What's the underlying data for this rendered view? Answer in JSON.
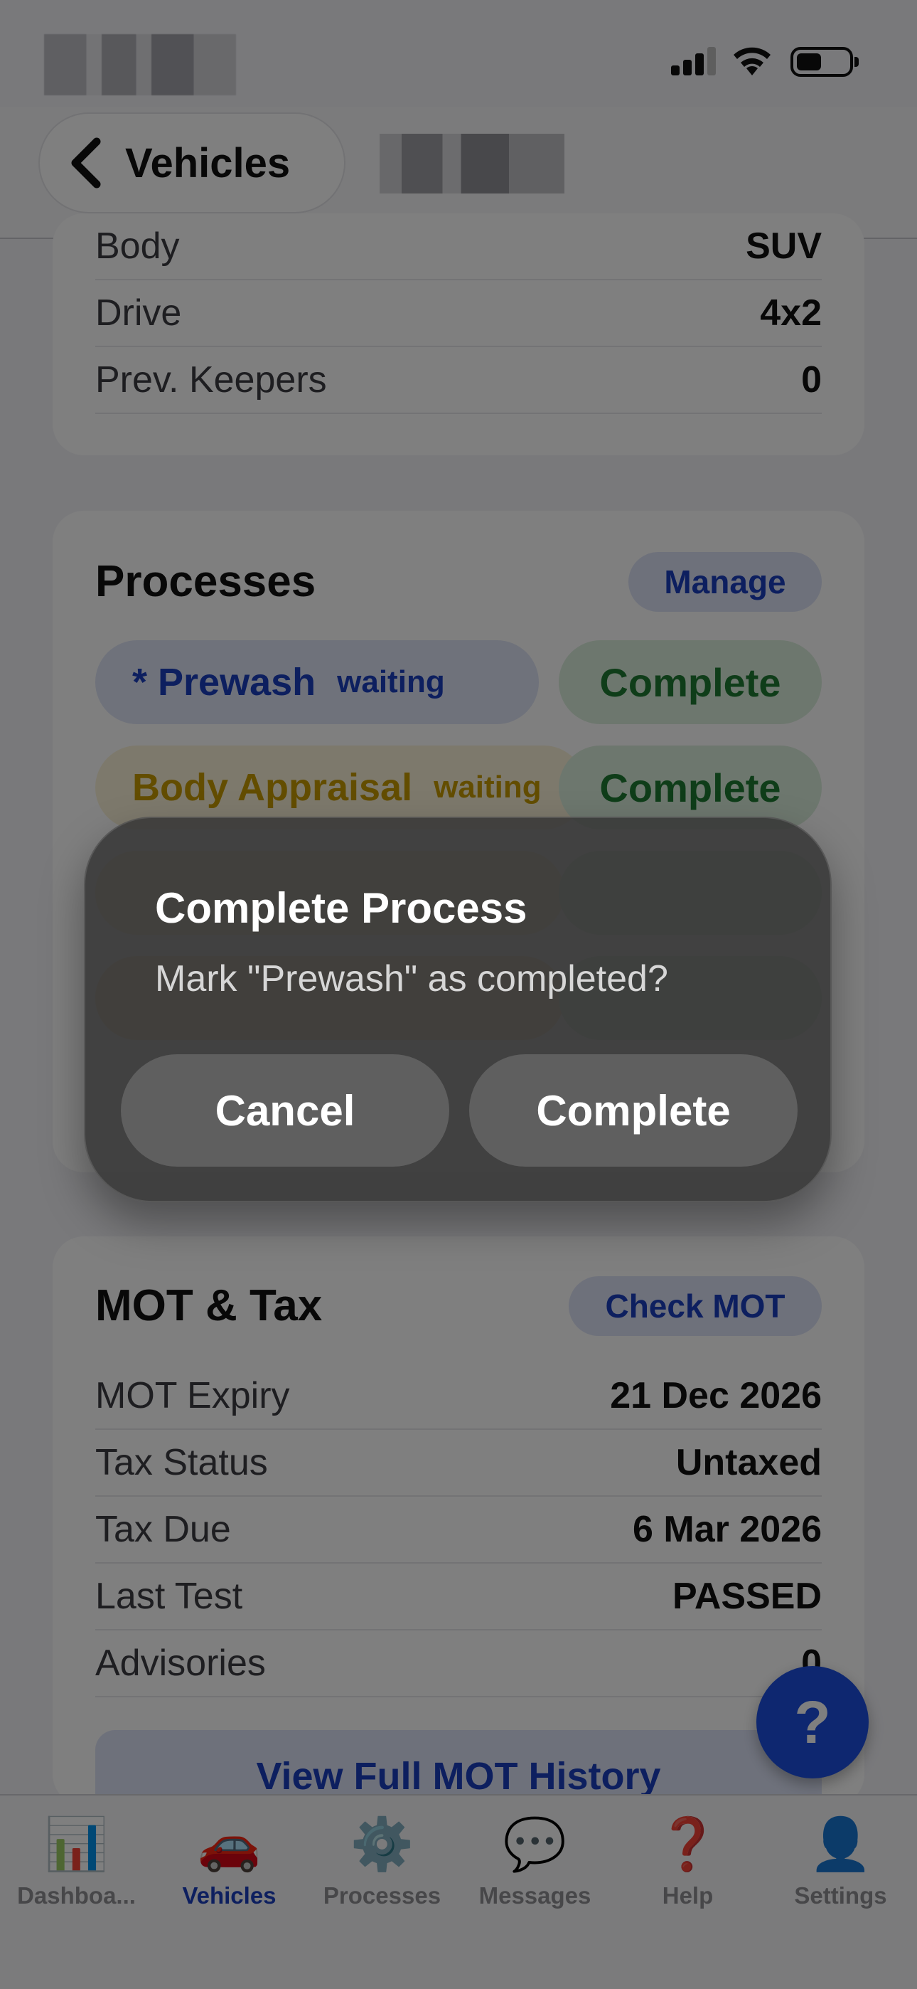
{
  "nav": {
    "back_label": "Vehicles"
  },
  "details": {
    "rows": [
      {
        "label": "Body",
        "value": "SUV"
      },
      {
        "label": "Drive",
        "value": "4x2"
      },
      {
        "label": "Prev. Keepers",
        "value": "0"
      }
    ]
  },
  "processes": {
    "title": "Processes",
    "manage_label": "Manage",
    "items": [
      {
        "name": "* Prewash",
        "state": "waiting",
        "action": "Complete",
        "chip_bg": "#dfe5f7",
        "color": "#1a3fbf"
      },
      {
        "name": "Body Appraisal",
        "state": "waiting",
        "action": "Complete",
        "chip_bg": "#fbf3d9",
        "color": "#c79a00"
      }
    ]
  },
  "mot": {
    "title": "MOT & Tax",
    "check_label": "Check MOT",
    "rows": [
      {
        "label": "MOT Expiry",
        "value": "21 Dec 2026"
      },
      {
        "label": "Tax Status",
        "value": "Untaxed"
      },
      {
        "label": "Tax Due",
        "value": "6 Mar 2026"
      },
      {
        "label": "Last Test",
        "value": "PASSED"
      },
      {
        "label": "Advisories",
        "value": "0"
      }
    ],
    "history_label": "View Full MOT History"
  },
  "help_fab": "?",
  "tabs": [
    {
      "label": "Dashboa...",
      "icon": "📊",
      "icon_name": "chart-icon"
    },
    {
      "label": "Vehicles",
      "icon": "🚗",
      "icon_name": "car-icon"
    },
    {
      "label": "Processes",
      "icon": "⚙️",
      "icon_name": "gear-icon"
    },
    {
      "label": "Messages",
      "icon": "💬",
      "icon_name": "speech-bubble-icon"
    },
    {
      "label": "Help",
      "icon": "❓",
      "icon_name": "question-icon"
    },
    {
      "label": "Settings",
      "icon": "👤",
      "icon_name": "person-icon"
    }
  ],
  "active_tab": "Vehicles",
  "alert": {
    "title": "Complete Process",
    "message": "Mark \"Prewash\" as completed?",
    "cancel_label": "Cancel",
    "confirm_label": "Complete"
  },
  "colors": {
    "accent": "#1a3fbf",
    "success": "#1e7a33",
    "warning": "#c79a00",
    "fab": "#1d4fe0"
  }
}
